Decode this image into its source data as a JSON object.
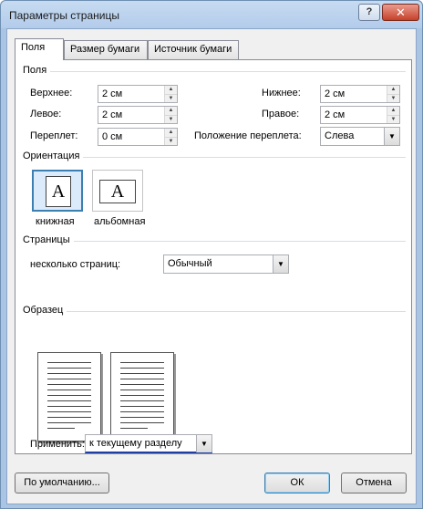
{
  "window": {
    "title": "Параметры страницы",
    "help_button": "?",
    "close_button": "✕"
  },
  "tabs": [
    {
      "label": "Поля"
    },
    {
      "label": "Размер бумаги"
    },
    {
      "label": "Источник бумаги"
    }
  ],
  "margins": {
    "section": "Поля",
    "top": {
      "label": "Верхнее:",
      "value": "2 см"
    },
    "bottom": {
      "label": "Нижнее:",
      "value": "2 см"
    },
    "left": {
      "label": "Левое:",
      "value": "2 см"
    },
    "right": {
      "label": "Правое:",
      "value": "2 см"
    },
    "gutter": {
      "label": "Переплет:",
      "value": "0 см"
    },
    "gutter_position": {
      "label": "Положение переплета:",
      "value": "Слева"
    }
  },
  "orientation": {
    "section": "Ориентация",
    "icon_letter": "A",
    "portrait": "книжная",
    "landscape": "альбомная"
  },
  "pages": {
    "section": "Страницы",
    "multiple_label": "несколько страниц:",
    "multiple_value": "Обычный"
  },
  "preview": {
    "section": "Образец"
  },
  "apply": {
    "label": "Применить:",
    "value": "к текущему разделу"
  },
  "buttons": {
    "default": "По умолчанию...",
    "ok": "ОК",
    "cancel": "Отмена"
  },
  "colors": {
    "accent": "#3c7fb1",
    "titlebar": "#b9d1ee",
    "close": "#c6402a"
  }
}
